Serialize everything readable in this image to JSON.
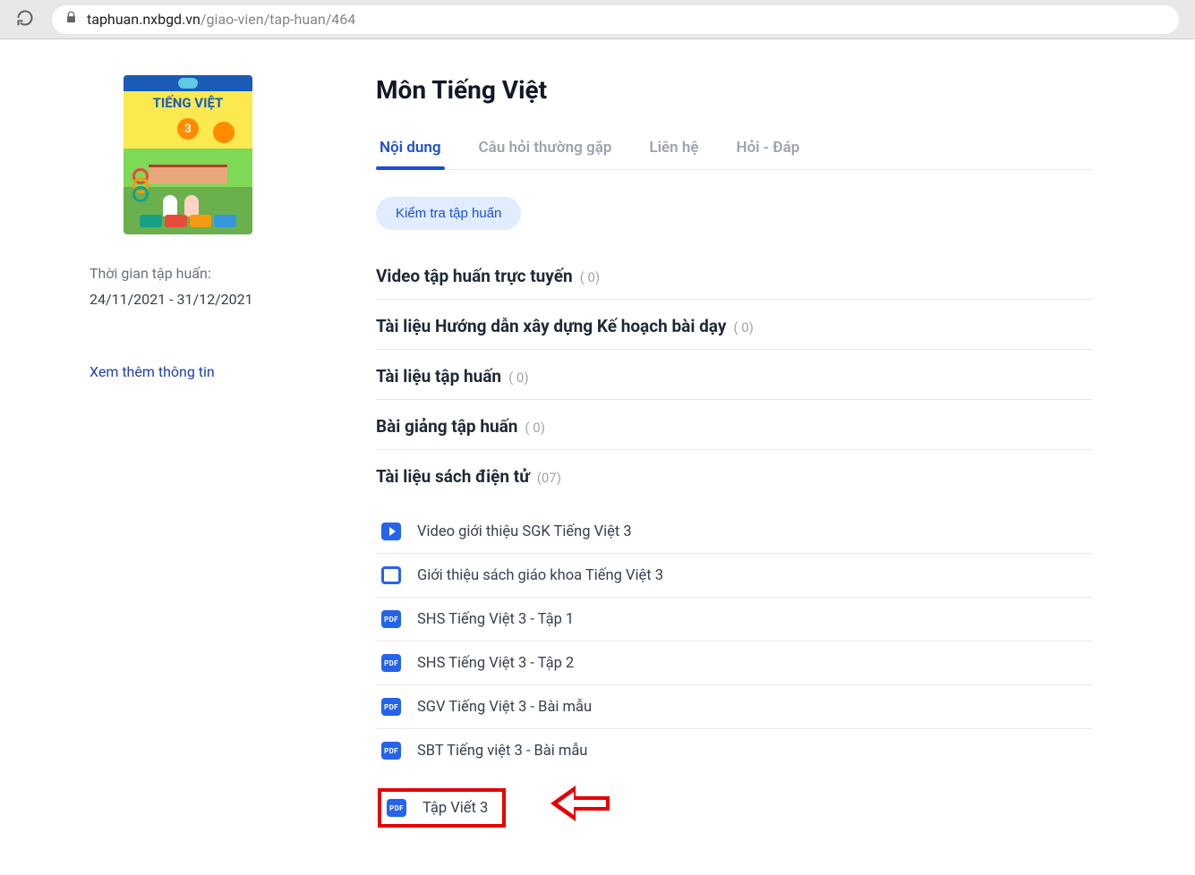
{
  "url": {
    "host": "taphuan.nxbgd.vn",
    "path": "/giao-vien/tap-huan/464"
  },
  "cover": {
    "title": "TIẾNG VIỆT",
    "grade": "3"
  },
  "sidebar": {
    "period_label": "Thời gian tập huấn:",
    "period_dates": "24/11/2021 - 31/12/2021",
    "more_link": "Xem thêm thông tin"
  },
  "page_title": "Môn Tiếng Việt",
  "tabs": {
    "items": [
      {
        "label": "Nội dung",
        "active": true
      },
      {
        "label": "Câu hỏi thường gặp",
        "active": false
      },
      {
        "label": "Liên hệ",
        "active": false
      },
      {
        "label": "Hỏi - Đáp",
        "active": false
      }
    ]
  },
  "check_button": "Kiểm tra tập huấn",
  "sections": [
    {
      "title": "Video tập huấn trực tuyến",
      "count": "( 0)"
    },
    {
      "title": "Tài liệu Hướng dẫn xây dựng Kế hoạch bài dạy",
      "count": "( 0)"
    },
    {
      "title": "Tài liệu tập huấn",
      "count": "( 0)"
    },
    {
      "title": "Bài giảng tập huấn",
      "count": "( 0)"
    },
    {
      "title": "Tài liệu sách điện tử",
      "count": "(07)"
    }
  ],
  "docs": [
    {
      "icon": "video",
      "label": "Video giới thiệu SGK Tiếng Việt 3"
    },
    {
      "icon": "slide",
      "label": "Giới thiệu sách giáo khoa Tiếng Việt 3"
    },
    {
      "icon": "pdf",
      "label": "SHS Tiếng Việt 3 - Tập 1"
    },
    {
      "icon": "pdf",
      "label": "SHS Tiếng Việt 3 - Tập 2"
    },
    {
      "icon": "pdf",
      "label": "SGV Tiếng Việt 3 - Bài mẫu"
    },
    {
      "icon": "pdf",
      "label": "SBT Tiếng việt 3 - Bài mẫu"
    },
    {
      "icon": "pdf",
      "label": "Tập Viết 3",
      "highlighted": true
    }
  ],
  "pdf_badge": "PDF"
}
